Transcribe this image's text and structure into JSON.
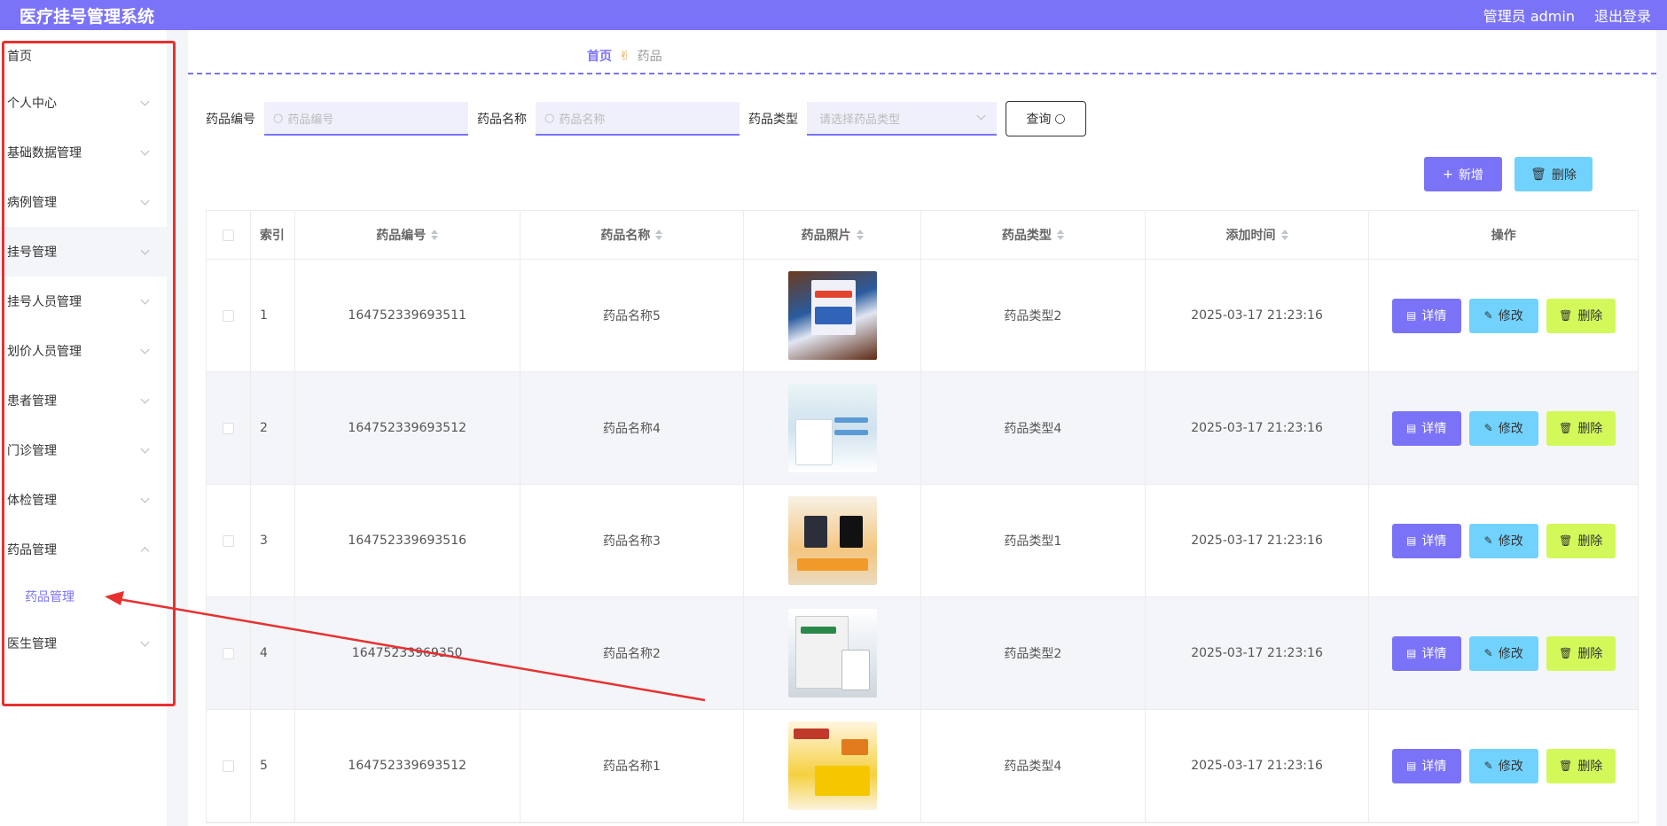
{
  "header": {
    "app_title": "医疗挂号管理系统",
    "user_label": "管理员 admin",
    "logout_label": "退出登录"
  },
  "sidebar": {
    "home": "首页",
    "items": [
      {
        "label": "个人中心"
      },
      {
        "label": "基础数据管理"
      },
      {
        "label": "病例管理"
      },
      {
        "label": "挂号管理"
      },
      {
        "label": "挂号人员管理"
      },
      {
        "label": "划价人员管理"
      },
      {
        "label": "患者管理"
      },
      {
        "label": "门诊管理"
      },
      {
        "label": "体检管理"
      },
      {
        "label": "药品管理",
        "expanded": true
      },
      {
        "label": "医生管理"
      }
    ],
    "sub_item": "药品管理"
  },
  "breadcrumb": {
    "home": "首页",
    "current": "药品"
  },
  "search": {
    "code_label": "药品编号",
    "code_placeholder": "药品编号",
    "name_label": "药品名称",
    "name_placeholder": "药品名称",
    "type_label": "药品类型",
    "type_placeholder": "请选择药品类型",
    "query_label": "查询"
  },
  "actions": {
    "add_label": "新增",
    "delete_label": "删除"
  },
  "table": {
    "columns": [
      "索引",
      "药品编号",
      "药品名称",
      "药品照片",
      "药品类型",
      "添加时间",
      "操作"
    ],
    "rows": [
      {
        "index": "1",
        "code": "164752339693511",
        "name": "药品名称5",
        "type": "药品类型2",
        "time": "2025-03-17 21:23:16"
      },
      {
        "index": "2",
        "code": "164752339693512",
        "name": "药品名称4",
        "type": "药品类型4",
        "time": "2025-03-17 21:23:16"
      },
      {
        "index": "3",
        "code": "164752339693516",
        "name": "药品名称3",
        "type": "药品类型1",
        "time": "2025-03-17 21:23:16"
      },
      {
        "index": "4",
        "code": "16475233969350",
        "name": "药品名称2",
        "type": "药品类型2",
        "time": "2025-03-17 21:23:16"
      },
      {
        "index": "5",
        "code": "164752339693512",
        "name": "药品名称1",
        "type": "药品类型4",
        "time": "2025-03-17 21:23:16"
      }
    ],
    "op_detail": "详情",
    "op_edit": "修改",
    "op_delete": "删除"
  },
  "colors": {
    "primary": "#7b73f7",
    "info": "#71d2fd",
    "lime": "#d3f85a",
    "annotation": "#e8302f"
  }
}
